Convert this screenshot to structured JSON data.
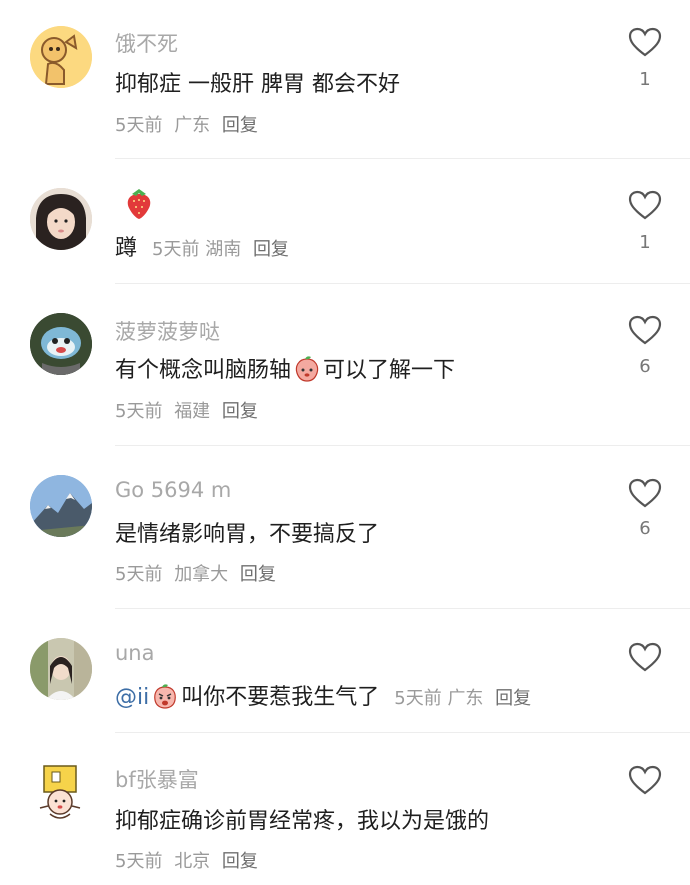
{
  "comments": [
    {
      "username": "饿不死",
      "text": "抑郁症 一般肝 脾胃 都会不好",
      "time": "5天前",
      "location": "广东",
      "reply": "回复",
      "likes": "1"
    },
    {
      "username": "",
      "text": "蹲",
      "time": "5天前",
      "location": "湖南",
      "reply": "回复",
      "likes": "1"
    },
    {
      "username": "菠萝菠萝哒",
      "text_before": "有个概念叫脑肠轴",
      "text_after": "可以了解一下",
      "time": "5天前",
      "location": "福建",
      "reply": "回复",
      "likes": "6"
    },
    {
      "username": "Go 5694 m",
      "text": "是情绪影响胃，不要搞反了",
      "time": "5天前",
      "location": "加拿大",
      "reply": "回复",
      "likes": "6"
    },
    {
      "username": "una",
      "mention": "@ii",
      "text": "叫你不要惹我生气了",
      "time": "5天前",
      "location": "广东",
      "reply": "回复",
      "likes": ""
    },
    {
      "username": "bf张暴富",
      "text": "抑郁症确诊前胃经常疼，我以为是饿的",
      "time": "5天前",
      "location": "北京",
      "reply": "回复",
      "likes": ""
    }
  ],
  "icons": {
    "like": "heart-outline-icon",
    "strawberry": "strawberry-emoji",
    "peach": "peach-emoji",
    "angry": "angry-face-emoji"
  },
  "colors": {
    "username": "#a8a8a8",
    "text": "#1f1f1f",
    "meta": "#9a9a9a",
    "mention": "#3d6ea6"
  }
}
